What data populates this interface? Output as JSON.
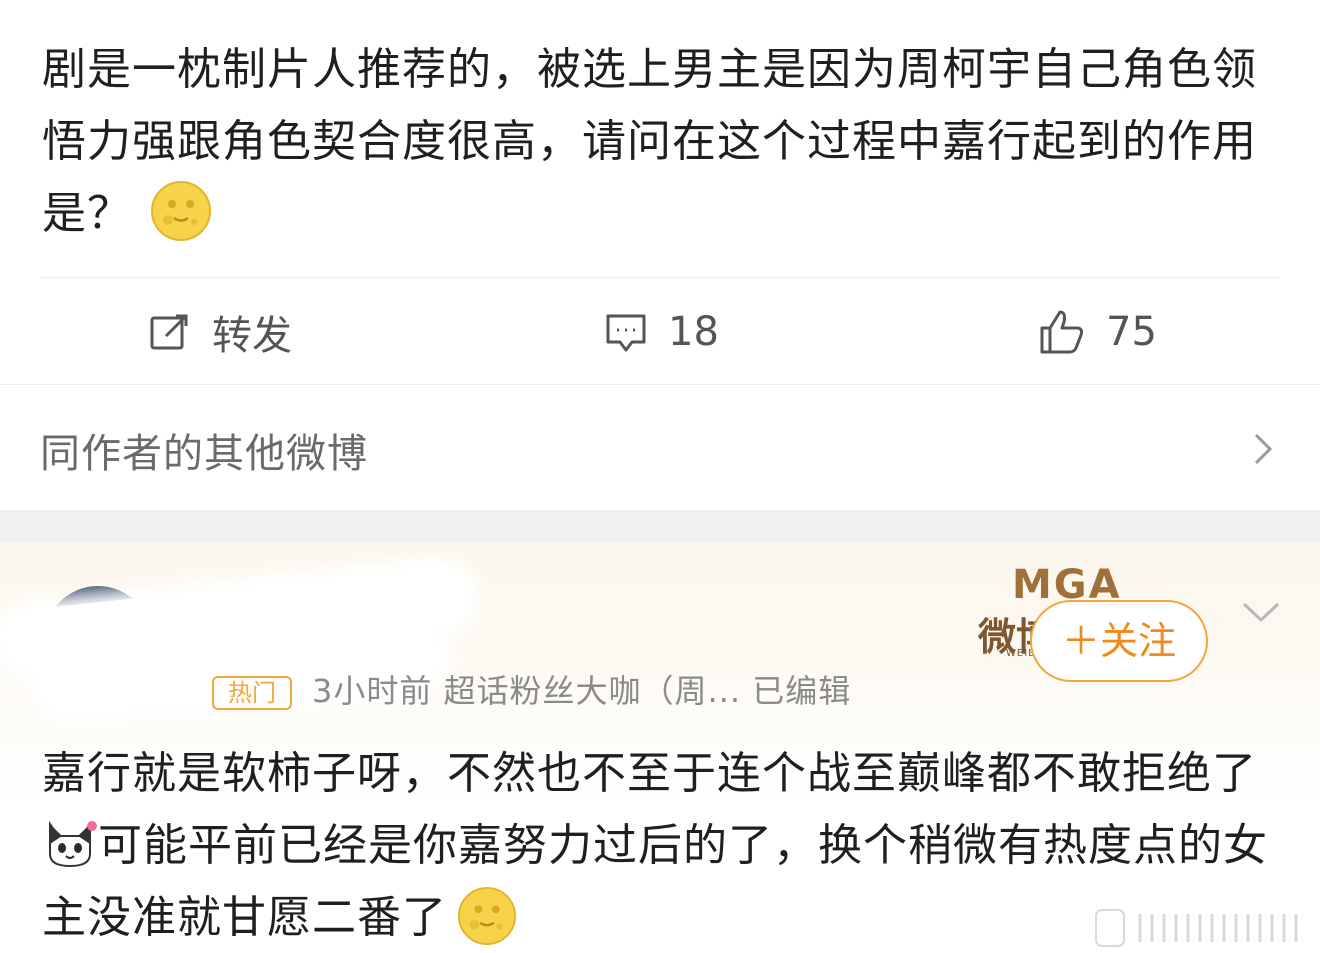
{
  "post": {
    "text": "剧是一枕制片人推荐的，被选上男主是因为周柯宇自己角色领悟力强跟角色契合度很高，请问在这个过程中嘉行起到的作用是？",
    "emoji": "moon-face-emoji"
  },
  "actions": {
    "repost_label": "转发",
    "comment_count": "18",
    "like_count": "75"
  },
  "other_posts": {
    "label": "同作者的其他微博"
  },
  "comment": {
    "hot_badge": "热门",
    "meta": "3小时前  超话粉丝大咖（周...  已编辑",
    "brand_logo": "MGA",
    "brand_sub": "微博",
    "brand_small": "WEIBO",
    "follow_label": "＋关注",
    "text_part1": "嘉行就是软柿子呀，不然也不至于连个战至巅峰都不敢拒绝了",
    "text_part2": "可能平前已经是你嘉努力过后的了，换个稍微有热度点的女主没准就甘愿二番了",
    "emoji_cat": "cat-emoji",
    "emoji_moon": "moon-face-emoji"
  },
  "colors": {
    "accent": "#f08a1a",
    "text": "#1f1f1f",
    "muted": "#8a8a8a",
    "band": "#efefef"
  }
}
